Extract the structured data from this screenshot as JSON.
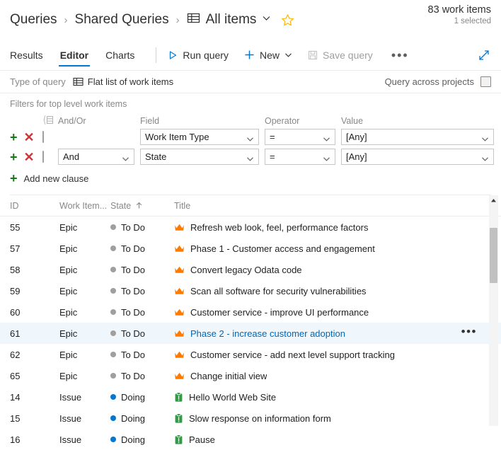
{
  "header": {
    "breadcrumb": [
      {
        "label": "Queries"
      },
      {
        "label": "Shared Queries"
      },
      {
        "label": "All items"
      }
    ],
    "separator": "›",
    "counts": {
      "total": "83 work items",
      "selected": "1 selected"
    }
  },
  "toolbar": {
    "tabs": [
      {
        "label": "Results",
        "active": false
      },
      {
        "label": "Editor",
        "active": true
      },
      {
        "label": "Charts",
        "active": false
      }
    ],
    "run_query": "Run query",
    "new": "New",
    "save_query": "Save query",
    "more": "•••"
  },
  "query_type": {
    "label": "Type of query",
    "value": "Flat list of work items",
    "across_projects_label": "Query across projects",
    "across_projects_checked": false
  },
  "filters": {
    "title": "Filters for top level work items",
    "columns": {
      "andor": "And/Or",
      "field": "Field",
      "operator": "Operator",
      "value": "Value"
    },
    "rows": [
      {
        "andor": "",
        "field": "Work Item Type",
        "operator": "=",
        "value": "[Any]"
      },
      {
        "andor": "And",
        "field": "State",
        "operator": "=",
        "value": "[Any]"
      }
    ],
    "add_clause": "Add new clause",
    "add_symbol": "+",
    "delete_symbol": "✕"
  },
  "results": {
    "columns": {
      "id": "ID",
      "type": "Work Item...",
      "state": "State",
      "title": "Title"
    },
    "sort": {
      "column": "State",
      "direction": "asc"
    },
    "rows": [
      {
        "id": "55",
        "type": "Epic",
        "state": "To Do",
        "title": "Refresh web look, feel, performance factors",
        "icon": "crown-icon",
        "state_color": "#a19f9d",
        "selected": false
      },
      {
        "id": "57",
        "type": "Epic",
        "state": "To Do",
        "title": "Phase 1 - Customer access and engagement",
        "icon": "crown-icon",
        "state_color": "#a19f9d",
        "selected": false
      },
      {
        "id": "58",
        "type": "Epic",
        "state": "To Do",
        "title": "Convert legacy Odata code",
        "icon": "crown-icon",
        "state_color": "#a19f9d",
        "selected": false
      },
      {
        "id": "59",
        "type": "Epic",
        "state": "To Do",
        "title": "Scan all software for security vulnerabilities",
        "icon": "crown-icon",
        "state_color": "#a19f9d",
        "selected": false
      },
      {
        "id": "60",
        "type": "Epic",
        "state": "To Do",
        "title": "Customer service - improve UI performance",
        "icon": "crown-icon",
        "state_color": "#a19f9d",
        "selected": false
      },
      {
        "id": "61",
        "type": "Epic",
        "state": "To Do",
        "title": "Phase 2 - increase customer adoption",
        "icon": "crown-icon",
        "state_color": "#a19f9d",
        "selected": true
      },
      {
        "id": "62",
        "type": "Epic",
        "state": "To Do",
        "title": "Customer service - add next level support tracking",
        "icon": "crown-icon",
        "state_color": "#a19f9d",
        "selected": false
      },
      {
        "id": "65",
        "type": "Epic",
        "state": "To Do",
        "title": "Change initial view",
        "icon": "crown-icon",
        "state_color": "#a19f9d",
        "selected": false
      },
      {
        "id": "14",
        "type": "Issue",
        "state": "Doing",
        "title": "Hello World Web Site",
        "icon": "clipboard-icon",
        "state_color": "#0078d4",
        "selected": false
      },
      {
        "id": "15",
        "type": "Issue",
        "state": "Doing",
        "title": "Slow response on information form",
        "icon": "clipboard-icon",
        "state_color": "#0078d4",
        "selected": false
      },
      {
        "id": "16",
        "type": "Issue",
        "state": "Doing",
        "title": "Pause",
        "icon": "clipboard-icon",
        "state_color": "#0078d4",
        "selected": false
      }
    ],
    "row_more": "•••"
  },
  "colors": {
    "accent": "#0078d4",
    "epic": "#ff7b00",
    "issue": "#339947",
    "selected_row": "#eff6fc",
    "add_green": "#107c10",
    "delete_red": "#d13438",
    "star": "#ffb900"
  }
}
